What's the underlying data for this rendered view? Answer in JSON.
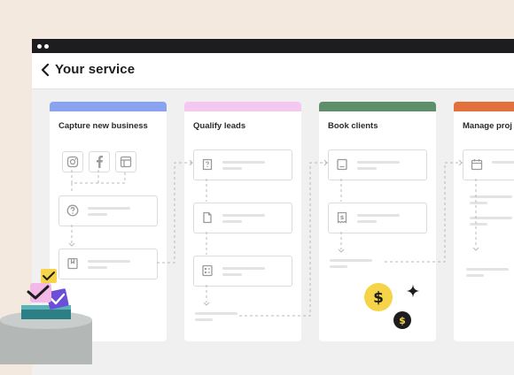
{
  "header": {
    "title": "Your service",
    "back_icon": "chevron-left-icon"
  },
  "columns": [
    {
      "label": "Capture new business",
      "color": "#8aa3f0"
    },
    {
      "label": "Qualify leads",
      "color": "#f4c8f1"
    },
    {
      "label": "Book clients",
      "color": "#5e8f6a"
    },
    {
      "label": "Manage proj",
      "color": "#e2703d"
    }
  ],
  "icons": {
    "capture": [
      "instagram-icon",
      "facebook-icon",
      "browser-icon",
      "question-icon",
      "bookmark-icon"
    ],
    "qualify": [
      "question-doc-icon",
      "document-icon",
      "form-icon"
    ],
    "book": [
      "invoice-icon",
      "receipt-dollar-icon"
    ],
    "manage": [
      "calendar-icon"
    ]
  },
  "badges": {
    "dollar_large": "$",
    "dollar_small": "$",
    "sparkle": "✦"
  },
  "colors": {
    "dollar_yellow": "#f5d547",
    "dark": "#1d1d1f"
  }
}
